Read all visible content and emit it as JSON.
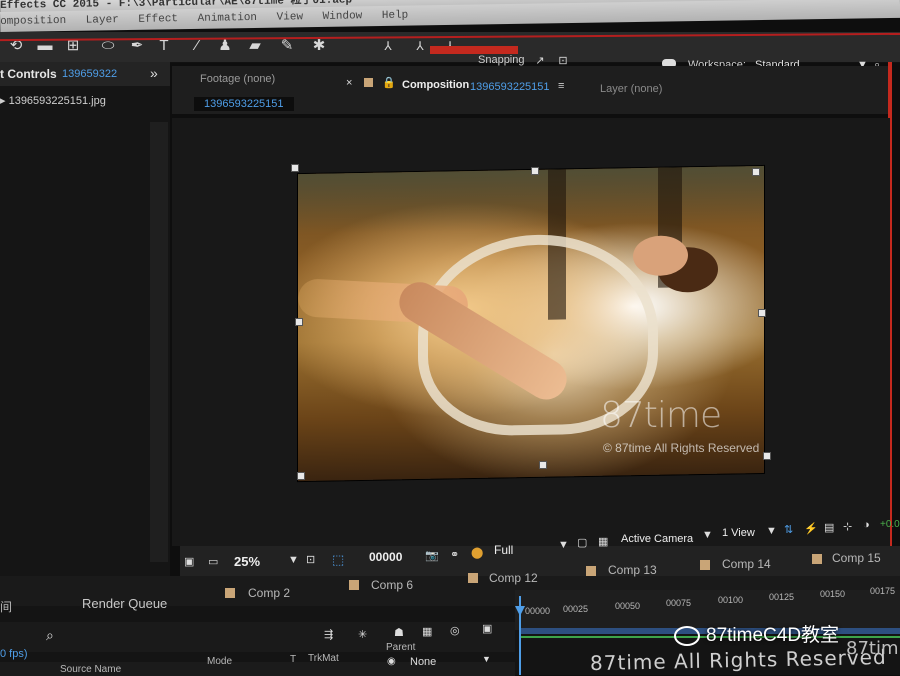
{
  "window": {
    "title": "Effects CC 2015 - F:\\3\\Particular\\AE\\87time 粒子01.aep *",
    "menu": [
      "omposition",
      "Layer",
      "Effect",
      "Animation",
      "View",
      "Window",
      "Help"
    ]
  },
  "toolbar": {
    "snapping_label": "Snapping",
    "workspace_label": "Workspace:",
    "workspace_value": "Standard"
  },
  "left_panel": {
    "title": "t Controls",
    "title_ref": "139659322",
    "file": "1396593225151.jpg"
  },
  "viewer_tabs": {
    "footage": "Footage (none)",
    "footage_file": "1396593225151",
    "composition_label": "Composition",
    "composition_ref": "1396593225151",
    "layer": "Layer (none)"
  },
  "viewer": {
    "watermark": "87time",
    "watermark_sub": "© 87time All Rights Reserved",
    "zoom": "25%",
    "timecode": "00000",
    "resolution": "Full",
    "camera": "Active Camera",
    "view": "1 View",
    "offset": "+0.0"
  },
  "comp_tabs": [
    "Comp 2",
    "Comp 6",
    "Comp 12",
    "Comp 13",
    "Comp 14",
    "Comp 15"
  ],
  "timeline": {
    "render_queue": "Render Queue",
    "left_char": "间",
    "fps": "0 fps)",
    "columns": {
      "source_name": "Source Name",
      "mode": "Mode",
      "t": "T",
      "trkmat": "TrkMat",
      "parent": "Parent",
      "parent_value": "None"
    },
    "ruler": [
      "00000",
      "00025",
      "00050",
      "00075",
      "00100",
      "00125",
      "00150",
      "00175"
    ],
    "wechat_watermark": "87timeC4D教室",
    "bottom_overlay": "87time All Rights Reserved",
    "bottom_overlay2": "87tim"
  }
}
